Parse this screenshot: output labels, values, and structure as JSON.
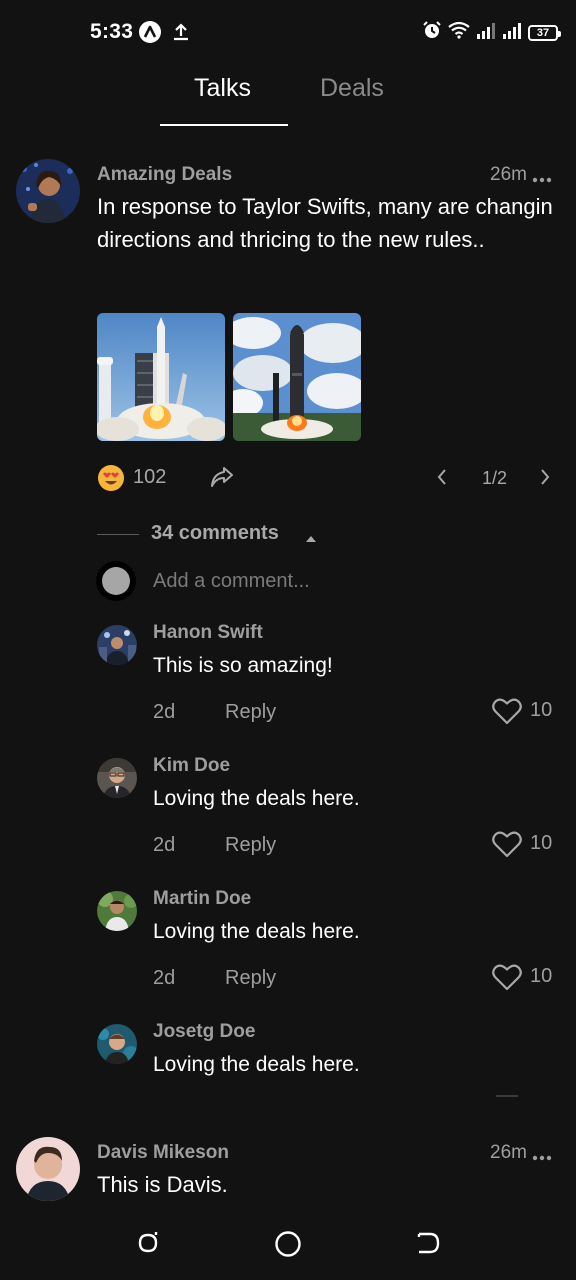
{
  "status_bar": {
    "time": "5:33",
    "battery": "37",
    "icons": [
      "a-app-icon",
      "upload-icon",
      "alarm-icon",
      "wifi-icon",
      "signal-icon",
      "signal-icon",
      "battery-icon"
    ]
  },
  "tabs": [
    {
      "label": "Talks",
      "active": true
    },
    {
      "label": "Deals",
      "active": false
    }
  ],
  "post": {
    "username": "Amazing Deals",
    "time": "26m",
    "text": "In response to Taylor Swifts, many are changin directions and thricing to the new rules..",
    "images": [
      "rocket-launch-image",
      "starship-launch-image"
    ],
    "reaction_icon": "heart-eyes-emoji-icon",
    "reaction_count": "102",
    "share_icon": "share-icon",
    "pager": "1/2"
  },
  "comments_section": {
    "count_label": "34 comments",
    "add_placeholder": "Add a comment...",
    "comments": [
      {
        "name": "Hanon Swift",
        "text": "This is so amazing!",
        "age": "2d",
        "reply": "Reply",
        "likes": "10"
      },
      {
        "name": "Kim Doe",
        "text": "Loving the deals here.",
        "age": "2d",
        "reply": "Reply",
        "likes": "10"
      },
      {
        "name": "Martin Doe",
        "text": "Loving the deals here.",
        "age": "2d",
        "reply": "Reply",
        "likes": "10"
      },
      {
        "name": "Josetg Doe",
        "text": "Loving the deals here."
      }
    ]
  },
  "next_post": {
    "username": "Davis Mikeson",
    "time": "26m",
    "text": "This is Davis."
  },
  "nav_bar": {
    "icons": [
      "recents-icon",
      "home-icon",
      "back-icon"
    ]
  },
  "colors": {
    "background": "#121212",
    "text_primary": "#ffffff",
    "text_secondary": "#9e9e9e"
  }
}
